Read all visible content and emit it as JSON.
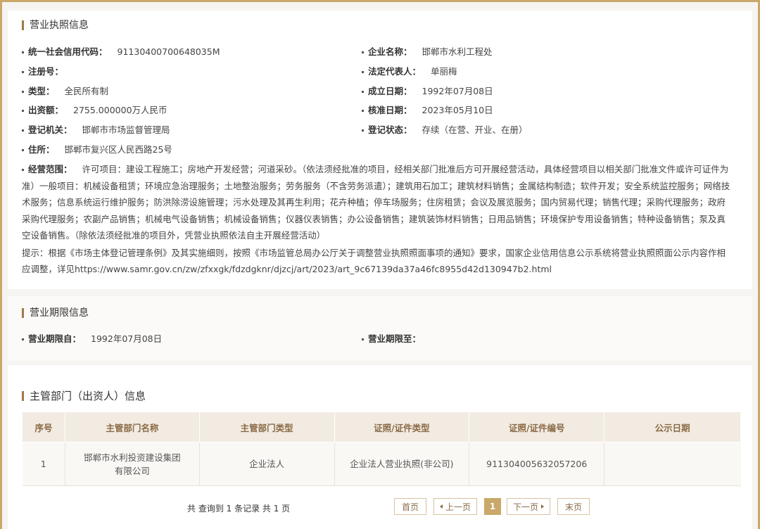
{
  "license": {
    "title": "营业执照信息",
    "credit_code_label": "统一社会信用代码：",
    "credit_code": "91130400700648035M",
    "company_name_label": "企业名称：",
    "company_name": "邯郸市水利工程处",
    "reg_no_label": "注册号：",
    "reg_no": "",
    "legal_rep_label": "法定代表人：",
    "legal_rep": "单丽梅",
    "type_label": "类型：",
    "type": "全民所有制",
    "established_label": "成立日期：",
    "established": "1992年07月08日",
    "capital_label": "出资额：",
    "capital": "2755.000000万人民币",
    "approved_label": "核准日期：",
    "approved": "2023年05月10日",
    "authority_label": "登记机关：",
    "authority": "邯郸市市场监督管理局",
    "status_label": "登记状态：",
    "status": "存续（在营、开业、在册）",
    "address_label": "住所：",
    "address": "邯郸市复兴区人民西路25号",
    "scope_label": "经营范围：",
    "scope": "许可项目：建设工程施工；房地产开发经营；河道采砂。（依法须经批准的项目，经相关部门批准后方可开展经营活动，具体经营项目以相关部门批准文件或许可证件为准）一般项目：机械设备租赁；环境应急治理服务；土地整治服务；劳务服务（不含劳务派遣）；建筑用石加工；建筑材料销售；金属结构制造；软件开发；安全系统监控服务；网络技术服务；信息系统运行维护服务；防洪除涝设施管理；污水处理及其再生利用；花卉种植；停车场服务；住房租赁；会议及展览服务；国内贸易代理；销售代理；采购代理服务；政府采购代理服务；农副产品销售；机械电气设备销售；机械设备销售；仪器仪表销售；办公设备销售；建筑装饰材料销售；日用品销售；环境保护专用设备销售；特种设备销售；泵及真空设备销售。（除依法须经批准的项目外，凭营业执照依法自主开展经营活动）",
    "tip": "提示：根据《市场主体登记管理条例》及其实施细则，按照《市场监管总局办公厅关于调整营业执照照面事项的通知》要求，国家企业信用信息公示系统将营业执照照面公示内容作相应调整，详见https://www.samr.gov.cn/zw/zfxxgk/fdzdgknr/djzcj/art/2023/art_9c67139da37a46fc8955d42d130947b2.html"
  },
  "term": {
    "title": "营业期限信息",
    "from_label": "营业期限自：",
    "from": "1992年07月08日",
    "to_label": "营业期限至：",
    "to": ""
  },
  "dept": {
    "title": "主管部门（出资人）信息",
    "columns": [
      "序号",
      "主管部门名称",
      "主管部门类型",
      "证照/证件类型",
      "证照/证件编号",
      "公示日期"
    ],
    "rows": [
      [
        "1",
        "邯郸市水利投资建设集团有限公司",
        "企业法人",
        "企业法人营业执照(非公司)",
        "911304005632057206",
        ""
      ]
    ],
    "pager_info": "共 查询到 1 条记录 共 1 页",
    "first": "首页",
    "prev": "上一页",
    "current": "1",
    "next": "下一页",
    "last": "末页"
  }
}
